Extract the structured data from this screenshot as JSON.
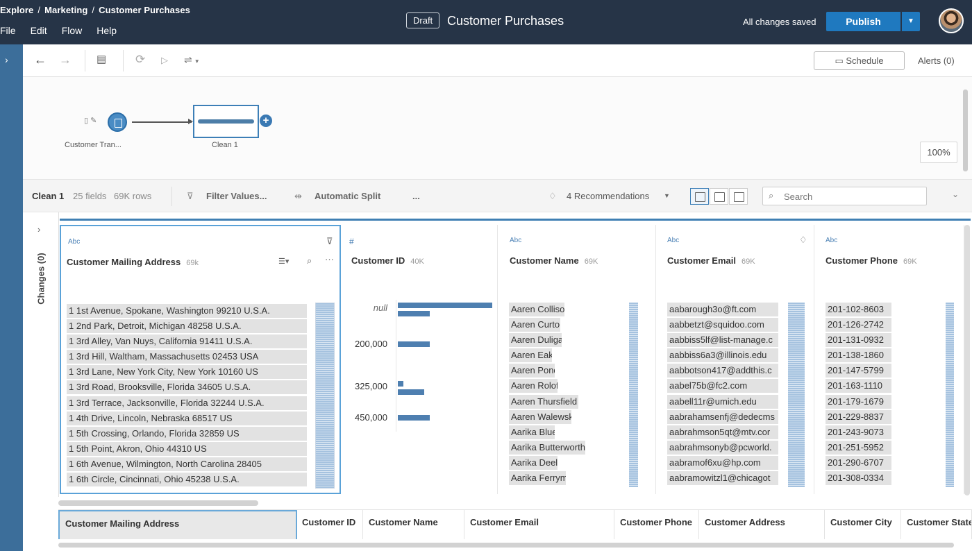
{
  "breadcrumb": [
    "Explore",
    "Marketing",
    "Customer Purchases"
  ],
  "menu": [
    "File",
    "Edit",
    "Flow",
    "Help"
  ],
  "header": {
    "badge": "Draft",
    "title": "Customer Purchases",
    "save_status": "All changes saved",
    "publish_label": "Publish"
  },
  "toolbar": {
    "schedule_label": "Schedule",
    "alerts_label": "Alerts (0)"
  },
  "flow": {
    "source_label": "Customer Tran...",
    "step_label": "Clean 1",
    "zoom": "100%"
  },
  "profile_header": {
    "step_name": "Clean 1",
    "fields": "25 fields",
    "rows": "69K rows",
    "filter_label": "Filter Values...",
    "split_label": "Automatic Split",
    "more_label": "...",
    "recommendations": "4 Recommendations",
    "search_placeholder": "Search"
  },
  "changes_label": "Changes (0)",
  "columns": [
    {
      "type": "Abc",
      "name": "Customer Mailing Address",
      "count": "69k",
      "values": [
        "1 1st Avenue, Spokane, Washington 99210 U.S.A.",
        "1 2nd Park, Detroit, Michigan 48258 U.S.A.",
        "1 3rd Alley, Van Nuys, California 91411 U.S.A.",
        "1 3rd Hill, Waltham, Massachusetts 02453 USA",
        "1 3rd Lane, New York City, New York 10160 US",
        "1 3rd Road, Brooksville, Florida 34605 U.S.A.",
        "1 3rd Terrace, Jacksonville, Florida 32244 U.S.A.",
        "1 4th Drive, Lincoln, Nebraska 68517 US",
        "1 5th Crossing, Orlando, Florida 32859 US",
        "1 5th Point, Akron, Ohio 44310 US",
        "1 6th Avenue, Wilmington, North Carolina 28405",
        "1 6th Circle, Cincinnati, Ohio 45238 U.S.A."
      ]
    },
    {
      "type": "#",
      "name": "Customer ID",
      "count": "40K",
      "bins": [
        {
          "label": "null",
          "bars": [
            1.0,
            0.34
          ]
        },
        {
          "label": "200,000",
          "bars": [
            0.34
          ]
        },
        {
          "label": "325,000",
          "bars": [
            0.06,
            0.28
          ]
        },
        {
          "label": "450,000",
          "bars": [
            0.34
          ]
        }
      ]
    },
    {
      "type": "Abc",
      "name": "Customer Name",
      "count": "69K",
      "values": [
        "Aaren Collison",
        "Aaren Curtois",
        "Aaren Duligall",
        "Aaren Eakle",
        "Aaren Ponde",
        "Aaren Roloff",
        "Aaren Thursfield",
        "Aaren Walewski",
        "Aarika Blues",
        "Aarika Butterworth",
        "Aarika Deelay",
        "Aarika Ferryman"
      ]
    },
    {
      "type": "Abc",
      "name": "Customer Email",
      "count": "69K",
      "values": [
        "aabarough3o@ft.com",
        "aabbetzt@squidoo.com",
        "aabbiss5lf@list-manage.c",
        "aabbiss6a3@illinois.edu",
        "aabbotson417@addthis.c",
        "aabel75b@fc2.com",
        "aabell11r@umich.edu",
        "aabrahamsenfj@dedecms",
        "aabrahmson5qt@mtv.cor",
        "aabrahmsonyb@pcworld.",
        "aabramof6xu@hp.com",
        "aabramowitzl1@chicagot"
      ]
    },
    {
      "type": "Abc",
      "name": "Customer Phone",
      "count": "69K",
      "values": [
        "201-102-8603",
        "201-126-2742",
        "201-131-0932",
        "201-138-1860",
        "201-147-5799",
        "201-163-1110",
        "201-179-1679",
        "201-229-8837",
        "201-243-9073",
        "201-251-5952",
        "201-290-6707",
        "201-308-0334"
      ]
    }
  ],
  "grid_headers": [
    "Customer Mailing Address",
    "Customer ID",
    "Customer Name",
    "Customer Email",
    "Customer Phone",
    "Customer Address",
    "Customer City",
    "Customer State"
  ],
  "colors": {
    "topbar": "#263447",
    "accent": "#1f79bf",
    "rail": "#3c6e9a",
    "bar": "#4e7fb0"
  }
}
